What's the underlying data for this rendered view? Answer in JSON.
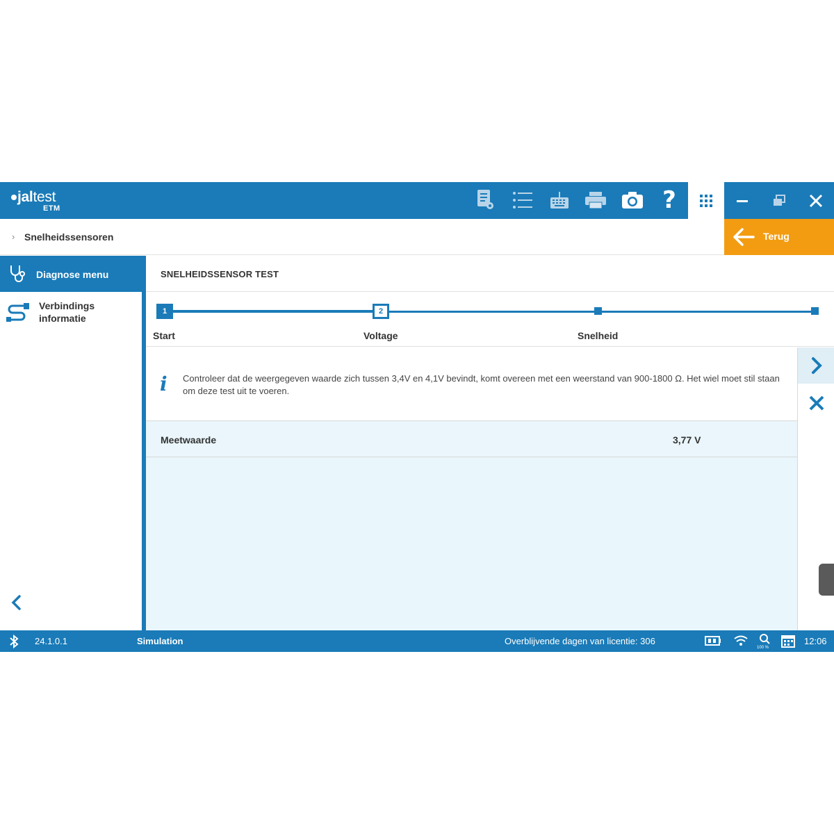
{
  "app": {
    "brand_bold": "jal",
    "brand_light": "test",
    "product": "ETM"
  },
  "toolbar": {
    "icons": [
      "document-icon",
      "list-icon",
      "keyboard-icon",
      "printer-icon",
      "camera-icon",
      "help-icon",
      "apps-grid-icon"
    ]
  },
  "window": {
    "minimize": "minimize-icon",
    "restore": "restore-icon",
    "close": "close-icon"
  },
  "breadcrumb": {
    "current": "Snelheidssensoren"
  },
  "back": {
    "label": "Terug"
  },
  "sidebar": {
    "items": [
      {
        "label": "Diagnose menu",
        "active": true
      },
      {
        "label_line1": "Verbindings",
        "label_line2": "informatie",
        "active": false
      }
    ]
  },
  "main": {
    "title": "SNELHEIDSSENSOR TEST",
    "steps": [
      {
        "number": "1",
        "label": "Start",
        "state": "done"
      },
      {
        "number": "2",
        "label": "Voltage",
        "state": "current"
      },
      {
        "number": "",
        "label": "Snelheid",
        "state": "pending"
      },
      {
        "number": "",
        "label": "",
        "state": "pending"
      }
    ],
    "info_text": "Controleer dat de weergegeven waarde zich tussen 3,4V en 4,1V bevindt, komt overeen met een weerstand van 900-1800 Ω. Het wiel moet stil staan om deze test uit te voeren.",
    "measurement": {
      "label": "Meetwaarde",
      "value": "3,77 V"
    }
  },
  "statusbar": {
    "version": "24.1.0.1",
    "mode": "Simulation",
    "license": "Overblijvende dagen van licentie: 306",
    "zoom": "100 %",
    "time": "12:06"
  },
  "colors": {
    "primary": "#1a7bb8",
    "accent": "#f39c12",
    "content_bg": "#e9f6fb"
  }
}
